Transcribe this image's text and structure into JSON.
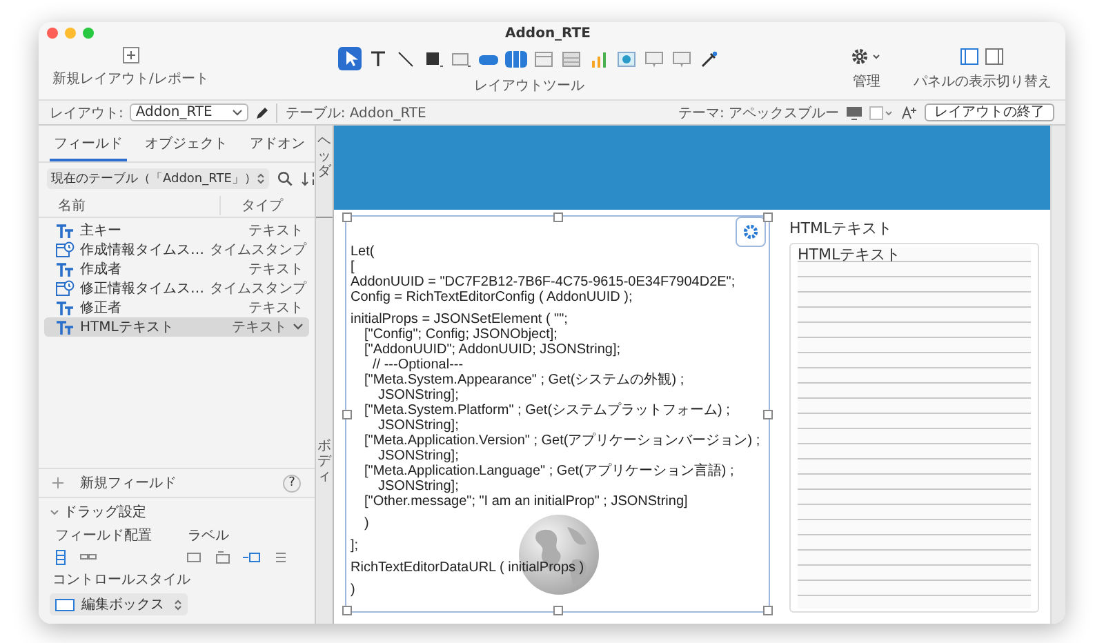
{
  "window": {
    "title": "Addon_RTE"
  },
  "toolbar": {
    "new_layout_label": "新規レイアウト/レポート",
    "tools": [
      {
        "kind": "pointer",
        "selected": true
      },
      {
        "kind": "text",
        "selected": false
      },
      {
        "kind": "line",
        "selected": false
      },
      {
        "kind": "shape",
        "selected": false
      },
      {
        "kind": "field",
        "selected": false
      },
      {
        "kind": "button",
        "selected": false
      },
      {
        "kind": "button-bar",
        "selected": false
      },
      {
        "kind": "panel",
        "selected": false
      },
      {
        "kind": "portal",
        "selected": false
      },
      {
        "kind": "chart",
        "selected": false
      },
      {
        "kind": "web",
        "selected": false
      },
      {
        "kind": "popover",
        "selected": false
      },
      {
        "kind": "popover",
        "selected": false
      },
      {
        "kind": "eyedropper",
        "selected": false
      }
    ],
    "tools_label": "レイアウトツール",
    "manage_label": "管理",
    "panels_label": "パネルの表示切り替え"
  },
  "layout_bar": {
    "layout_label": "レイアウト:",
    "layout_value": "Addon_RTE",
    "table": "テーブル: Addon_RTE",
    "theme": "テーマ: アペックスブルー",
    "exit_button": "レイアウトの終了"
  },
  "sidebar": {
    "tabs": [
      {
        "label": "フィールド",
        "selected": true
      },
      {
        "label": "オブジェクト",
        "selected": false
      },
      {
        "label": "アドオン",
        "selected": false
      }
    ],
    "table_selector": "現在のテーブル（「Addon_RTE」）",
    "columns": [
      "名前",
      "タイプ"
    ],
    "fields": [
      {
        "name": "主キー",
        "type": "テキスト",
        "kind": "text",
        "selected": false
      },
      {
        "name": "作成情報タイムス…",
        "type": "タイムスタンプ",
        "kind": "timestamp",
        "selected": false
      },
      {
        "name": "作成者",
        "type": "テキスト",
        "kind": "text",
        "selected": false
      },
      {
        "name": "修正情報タイムス…",
        "type": "タイムスタンプ",
        "kind": "timestamp",
        "selected": false
      },
      {
        "name": "修正者",
        "type": "テキスト",
        "kind": "text",
        "selected": false
      },
      {
        "name": "HTMLテキスト",
        "type": "テキスト",
        "kind": "text",
        "selected": true
      }
    ],
    "new_field": "新規フィールド",
    "help": "?",
    "drag_settings": {
      "title": "ドラッグ設定",
      "expanded": true,
      "placement_label": "フィールド配置",
      "label_label": "ラベル",
      "placement_options": [
        {
          "selected": true
        },
        {
          "selected": false
        }
      ],
      "label_options": [
        {
          "selected": false
        },
        {
          "selected": false
        },
        {
          "selected": true
        },
        {
          "selected": false
        }
      ],
      "control_style_label": "コントロールスタイル",
      "control_style": "編集ボックス"
    }
  },
  "parts": [
    {
      "label": "ヘッダ"
    },
    {
      "label": "ボディ"
    }
  ],
  "web_viewer": {
    "code_blocks": [
      {
        "lines": [
          {
            "text": "Let(",
            "kind": "line"
          },
          {
            "text": "[",
            "kind": "line"
          },
          {
            "text": "AddonUUID = \"DC7F2B12-7B6F-4C75-9615-0E34F7904D2E\";",
            "kind": "line"
          },
          {
            "text": "Config = RichTextEditorConfig ( AddonUUID );",
            "kind": "line"
          }
        ]
      },
      {
        "lines": [
          {
            "text": "initialProps = JSONSetElement ( \"\";",
            "kind": "line"
          },
          {
            "text": "[\"Config\"; Config; JSONObject];",
            "kind": "indented"
          },
          {
            "text": "[\"AddonUUID\"; AddonUUID; JSONString];",
            "kind": "indented"
          },
          {
            "text": "// ---Optional---",
            "kind": "comment"
          },
          {
            "text": "[\"Meta.System.Appearance\" ; Get(システムの外観) ; JSONString];",
            "kind": "indented"
          },
          {
            "text": "[\"Meta.System.Platform\" ; Get(システムプラットフォーム) ; JSONString];",
            "kind": "indented"
          },
          {
            "text": "[\"Meta.Application.Version\" ; Get(アプリケーションバージョン) ; JSONString];",
            "kind": "indented"
          },
          {
            "text": "[\"Meta.Application.Language\" ; Get(アプリケーション言語) ; JSONString];",
            "kind": "indented"
          },
          {
            "text": "[\"Other.message\"; \"I am an initialProp\" ; JSONString]",
            "kind": "indented"
          }
        ]
      },
      {
        "lines": [
          {
            "text": ")",
            "kind": "indented"
          }
        ]
      },
      {
        "lines": [
          {
            "text": "];",
            "kind": "line"
          }
        ]
      },
      {
        "lines": [
          {
            "text": "RichTextEditorDataURL ( initialProps )",
            "kind": "line"
          }
        ]
      },
      {
        "lines": [
          {
            "text": ")",
            "kind": "line"
          }
        ]
      }
    ]
  },
  "html_field": {
    "label": "HTMLテキスト",
    "value": "HTMLテキスト"
  }
}
